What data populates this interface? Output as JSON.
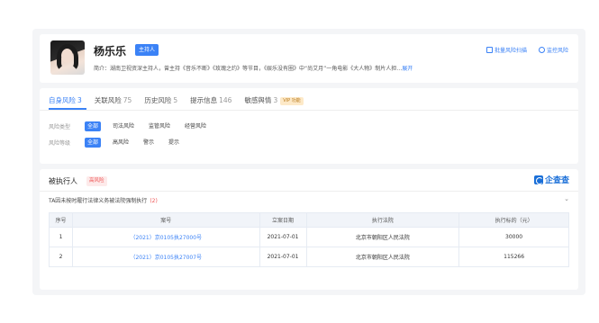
{
  "header": {
    "name": "杨乐乐",
    "tag": "主持人",
    "intro": "简介：湖南卫视资深主持人，曾主持《音乐不断》《玫瑰之约》等节目，《娱乐没有圈》中“尚艾月”一角电影《大人物》制片人担…",
    "intro_more": "展开",
    "links": {
      "batch_scan": "批量风险扫描",
      "monitor": "监控风险"
    }
  },
  "risk": {
    "tabs": [
      {
        "label": "自身风险",
        "count": "3"
      },
      {
        "label": "关联风险",
        "count": "75"
      },
      {
        "label": "历史风险",
        "count": "5"
      },
      {
        "label": "提示信息",
        "count": "146"
      },
      {
        "label": "敏感舆情",
        "count": "3"
      }
    ],
    "vip_badge": "VIP 功能",
    "filters": [
      {
        "label": "风险类型",
        "chips": [
          "全部",
          "司法风险",
          "监管风险",
          "经营风险"
        ]
      },
      {
        "label": "风险等级",
        "chips": [
          "全部",
          "高风险",
          "警示",
          "提示"
        ]
      }
    ]
  },
  "exec": {
    "title": "被执行人",
    "tag": "高风险",
    "brand": "企查查",
    "sub": "TA因未按时履行法律义务被法院强制执行",
    "sub_count": "(2)",
    "columns": [
      "序号",
      "案号",
      "立案日期",
      "执行法院",
      "执行标的（元）"
    ],
    "rows": [
      [
        "1",
        "（2021）京0105执27000号",
        "2021-07-01",
        "北京市朝阳区人民法院",
        "30000"
      ],
      [
        "2",
        "（2021）京0105执27007号",
        "2021-07-01",
        "北京市朝阳区人民法院",
        "115266"
      ]
    ]
  },
  "colors": {
    "accent": "#3b82f6",
    "danger": "#e55555",
    "brand": "#1a6fd8"
  }
}
